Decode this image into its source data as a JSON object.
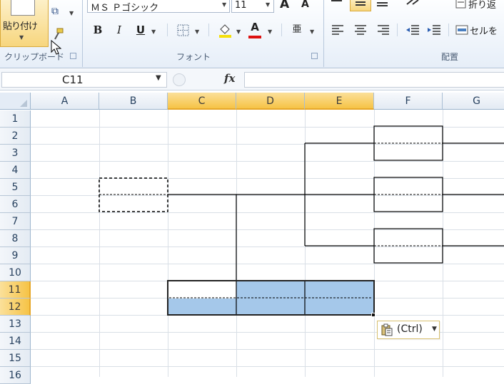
{
  "ribbon": {
    "clipboard": {
      "paste_label": "貼り付け",
      "group_label": "クリップボード"
    },
    "font": {
      "group_label": "フォント",
      "font_name": "ＭＳ Ｐゴシック",
      "font_size": "11",
      "bold": "B",
      "italic": "I",
      "underline": "U",
      "font_color_glyph": "A",
      "grow_font": "A",
      "shrink_font": "A"
    },
    "alignment": {
      "group_label": "配置",
      "wrap_text": "折り返",
      "merge": "セルを"
    }
  },
  "formula_bar": {
    "name_box": "C11",
    "fx": "fx",
    "formula": ""
  },
  "grid": {
    "columns": [
      "A",
      "B",
      "C",
      "D",
      "E",
      "F",
      "G"
    ],
    "selected_columns": [
      "C",
      "D",
      "E"
    ],
    "rows": [
      "1",
      "2",
      "3",
      "4",
      "5",
      "6",
      "7",
      "8",
      "9",
      "10",
      "11",
      "12",
      "13",
      "14",
      "15",
      "16"
    ],
    "selected_rows": [
      "11",
      "12"
    ],
    "active_cell": "C11",
    "selection": "C11:E12"
  },
  "paste_options": {
    "label": "(Ctrl)"
  },
  "colors": {
    "selection_fill": "#a5c8ea",
    "header_selected": "#f6c346",
    "gridline": "#d9dfe6"
  }
}
